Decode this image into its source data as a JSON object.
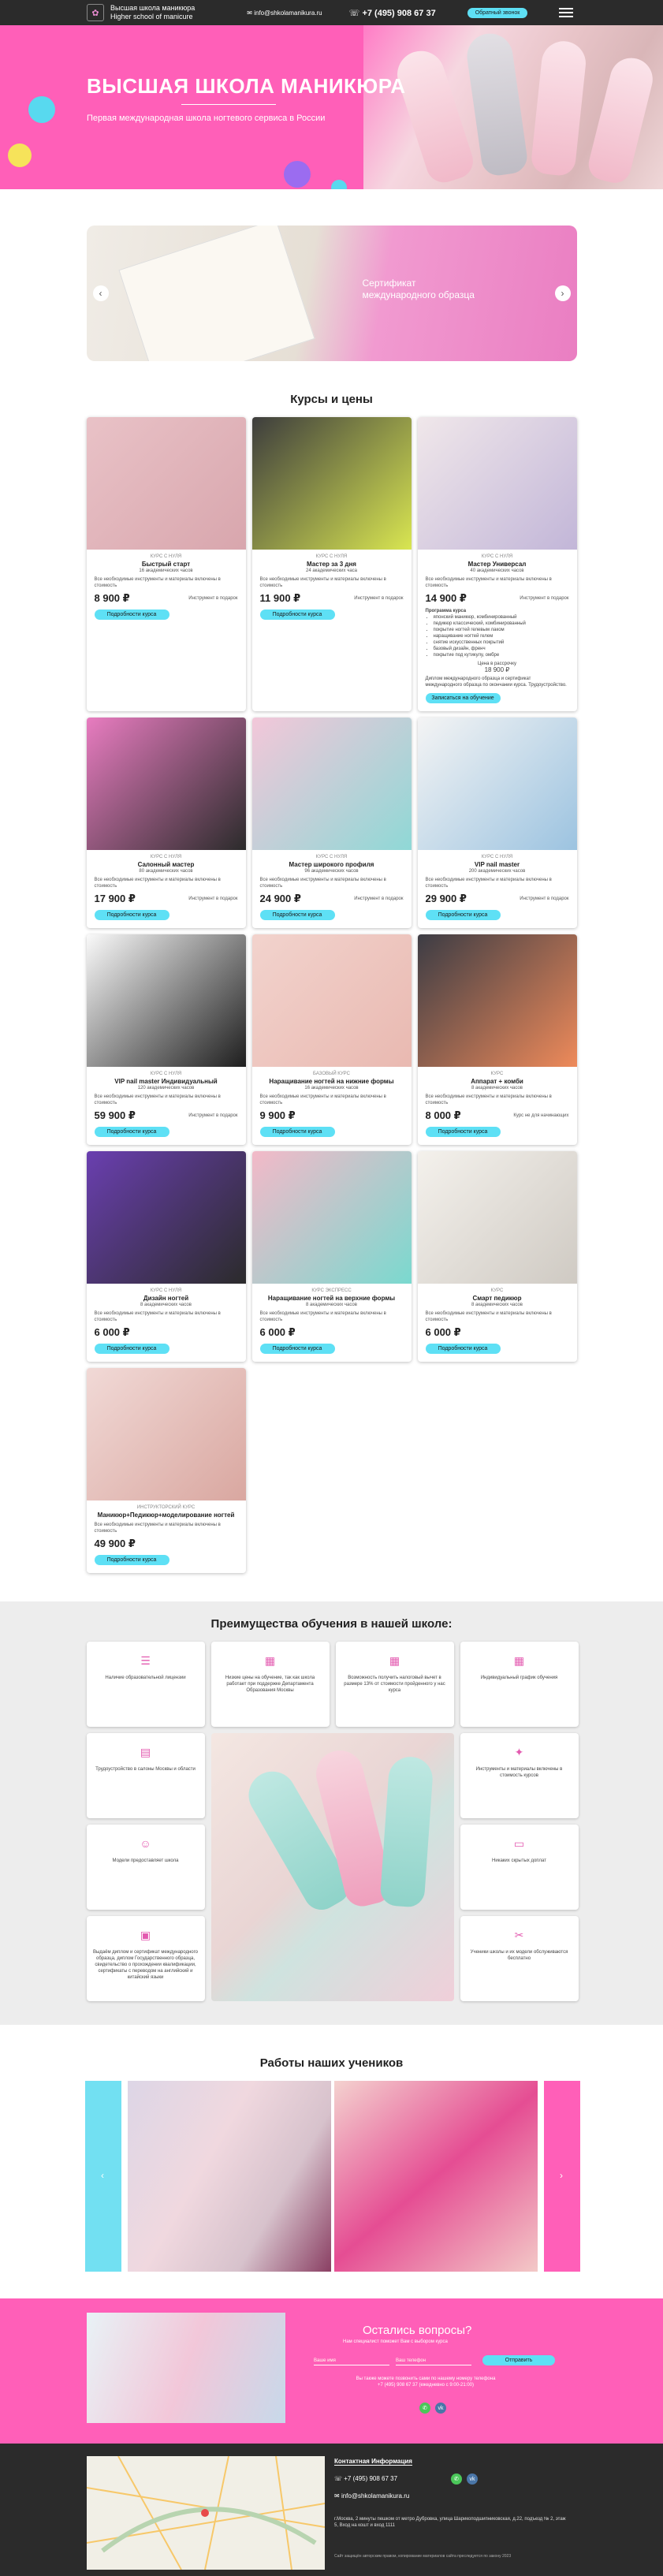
{
  "header": {
    "brand_line1": "Высшая школа маникюра",
    "brand_line2": "Higher school of manicure",
    "email": "info@shkolamanikura.ru",
    "phone": "+7 (495) 908 67 37",
    "call_button": "Обратный звонок"
  },
  "hero": {
    "title": "ВЫСШАЯ ШКОЛА МАНИКЮРА",
    "subtitle": "Первая международная школа ногтевого сервиса в России"
  },
  "slider": {
    "caption": "Сертификат международного образца"
  },
  "courses": {
    "title": "Курсы и цены",
    "button_label": "Подробности курса",
    "items": [
      {
        "type": "Курс с нуля",
        "name": "Быстрый старт",
        "hours": "16 академических часов",
        "desc": "Все необходимые инструменты и материалы включены в стоимость",
        "price": "8 900 ₽",
        "note": "Инструмент в подарок",
        "colors": [
          "#e9c2c7",
          "#d8a6ad"
        ]
      },
      {
        "type": "Курс с нуля",
        "name": "Мастер за 3 дня",
        "hours": "24 академических часа",
        "desc": "Все необходимые инструменты и материалы включены в стоимость",
        "price": "11 900 ₽",
        "note": "Инструмент в подарок",
        "colors": [
          "#3d3d3d",
          "#d9e651"
        ]
      },
      {
        "type": "Курс с нуля",
        "name": "Мастер Универсал",
        "hours": "40 академических часов",
        "desc": "Все необходимые инструменты и материалы включены в стоимость",
        "price": "14 900 ₽",
        "note": "Инструмент в подарок",
        "colors": [
          "#f0e7ea",
          "#c2b6d8"
        ]
      },
      {
        "type": "Курс с нуля",
        "name": "Салонный мастер",
        "hours": "80 академических часов",
        "desc": "Все необходимые инструменты и материалы включены в стоимость",
        "price": "17 900 ₽",
        "note": "Инструмент в подарок",
        "colors": [
          "#e87cc0",
          "#2b2b2b"
        ]
      },
      {
        "type": "Курс с нуля",
        "name": "Мастер широкого профиля",
        "hours": "96 академических часов",
        "desc": "Все необходимые инструменты и материалы включены в стоимость",
        "price": "24 900 ₽",
        "note": "Инструмент в подарок",
        "colors": [
          "#f3c7d9",
          "#8fd8d6"
        ]
      },
      {
        "type": "Курс с нуля",
        "name": "VIP nail master",
        "hours": "200 академических часов",
        "desc": "Все необходимые инструменты и материалы включены в стоимость",
        "price": "29 900 ₽",
        "note": "Инструмент в подарок",
        "colors": [
          "#f4f4f4",
          "#9cc3e0"
        ]
      },
      {
        "type": "Курс с нуля",
        "name": "VIP nail master Индивидуальный",
        "hours": "120 академических часов",
        "desc": "Все необходимые инструменты и материалы включены в стоимость",
        "price": "59 900 ₽",
        "note": "Инструмент в подарок",
        "colors": [
          "#fafafa",
          "#1e1e1e"
        ]
      },
      {
        "type": "Базовый курс",
        "name": "Наращивание ногтей на нижние формы",
        "hours": "16 академических часов",
        "desc": "Все необходимые инструменты и материалы включены в стоимость",
        "price": "9 900 ₽",
        "note": "",
        "colors": [
          "#f2d3cd",
          "#e9b9b1"
        ]
      },
      {
        "type": "Курс",
        "name": "Аппарат + комби",
        "hours": "8 академических часов",
        "desc": "Все необходимые инструменты и материалы включены в стоимость",
        "price": "8 000 ₽",
        "note": "Курс не для начинающих",
        "colors": [
          "#3c3c44",
          "#ee8a5a"
        ]
      },
      {
        "type": "Курс с нуля",
        "name": "Дизайн ногтей",
        "hours": "8 академических часов",
        "desc": "Все необходимые инструменты и материалы включены в стоимость",
        "price": "6 000 ₽",
        "note": "",
        "colors": [
          "#6a3fb0",
          "#2b2b2b"
        ]
      },
      {
        "type": "Курс экспресс",
        "name": "Наращивание ногтей на верхние формы",
        "hours": "8 академических часов",
        "desc": "Все необходимые инструменты и материалы включены в стоимость",
        "price": "6 000 ₽",
        "note": "",
        "colors": [
          "#f3b9c8",
          "#7ad9cf"
        ]
      },
      {
        "type": "Курс",
        "name": "Смарт педикюр",
        "hours": "8 академических часов",
        "desc": "Все необходимые инструменты и материалы включены в стоимость",
        "price": "6 000 ₽",
        "note": "",
        "colors": [
          "#f4f1ec",
          "#cfcac3"
        ]
      },
      {
        "type": "Инструкторский курс",
        "name": "Маникюр+Педикюр+моделирование ногтей",
        "hours": "",
        "desc": "Все необходимые инструменты и материалы включены в стоимость",
        "price": "49 900 ₽",
        "note": "",
        "colors": [
          "#f1d9d6",
          "#d9a7a0"
        ]
      }
    ]
  },
  "program": {
    "title": "Программа курса",
    "items": [
      "японский маникюр, комбинированный",
      "педикюр классический, комбинированный",
      "покрытие ногтей гелевым лаком",
      "наращивание ногтей гелем",
      "снятие искусственных покрытий",
      "базовый дизайн, френч",
      "покрытие под кутикулу, омбре"
    ],
    "installment_label": "Цена в рассрочку",
    "installment_price": "18 900 ₽",
    "diploma": "Диплом международного образца и сертификат международного образца по окончании курса. Трудоустройство.",
    "signup": "Записаться на обучение"
  },
  "advantages": {
    "title": "Преимущества обучения в нашей школе:",
    "items": [
      {
        "icon": "license-icon",
        "text": "Наличие образовательной лицензии"
      },
      {
        "icon": "calendar-icon",
        "text": "Низкие цены на обучение, так как школа работает при поддержке Департамента Образования Москвы"
      },
      {
        "icon": "calendar-icon",
        "text": "Возможность получить налоговый вычет в размере 13% от стоимости пройденного у нас курса"
      },
      {
        "icon": "calendar-icon",
        "text": "Индивидуальный график обучения"
      },
      {
        "icon": "doc-icon",
        "text": "Трудоустройство в салоны Москвы и области"
      },
      {
        "icon": "tools-icon",
        "text": "Инструменты и материалы включены в стоимость курсов"
      },
      {
        "icon": "model-icon",
        "text": "Модели предоставляет школа"
      },
      {
        "icon": "card-icon",
        "text": "Никаких скрытых доплат"
      },
      {
        "icon": "diploma-icon",
        "text": "Выдаём диплом и сертификат международного образца, диплом Государственного образца, свидетельство о прохождении квалификации, сертификаты с переводом на английский и китайский языки"
      },
      {
        "icon": "scissors-icon",
        "text": "Ученики школы и их модели обслуживаются бесплатно"
      }
    ]
  },
  "works": {
    "title": "Работы наших учеников"
  },
  "contact": {
    "title": "Остались вопросы?",
    "subtitle": "Нам специалист поможет Вам с выбором курса",
    "name_placeholder": "Ваше имя",
    "phone_placeholder": "Ваш телефон",
    "button": "Отправить",
    "note1": "Вы также можете позвонить сами по нашему номеру телефона",
    "note2": "+7 (495) 908 67 37 (ежедневно с 9:00-21:00)"
  },
  "footer": {
    "title": "Контактная Информация",
    "phone": "+7 (495) 908 67 37",
    "email": "info@shkolamanikura.ru",
    "address": "г.Москва, 2 минуты пешком от метро Дубровка, улица Шарикоподшипниковская, д.22, подъезд № 2, этаж 5, Вход на кошт и вход 1111",
    "copy": "Сайт защищён авторским правом, копирование материалов сайта преследуется по закону 2023"
  }
}
